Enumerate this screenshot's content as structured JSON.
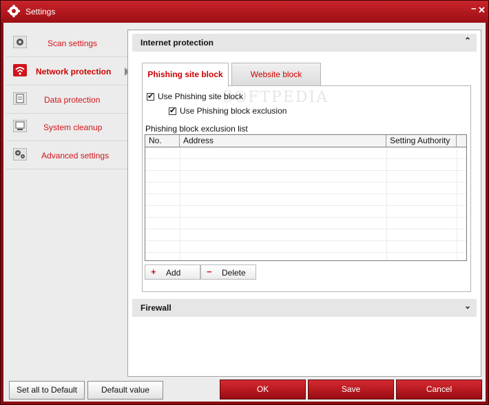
{
  "window": {
    "title": "Settings",
    "minimize": "−",
    "close": "✕"
  },
  "sidebar": {
    "items": [
      {
        "label": "Scan settings",
        "icon": "gear-icon"
      },
      {
        "label": "Network protection",
        "icon": "wifi-icon",
        "active": true
      },
      {
        "label": "Data protection",
        "icon": "document-icon"
      },
      {
        "label": "System cleanup",
        "icon": "monitor-icon"
      },
      {
        "label": "Advanced settings",
        "icon": "gears-icon"
      }
    ]
  },
  "sections": {
    "internet": {
      "title": "Internet protection",
      "chevron": "⌃"
    },
    "firewall": {
      "title": "Firewall",
      "chevron": "⌄"
    }
  },
  "tabs": [
    {
      "label": "Phishing site block",
      "active": true
    },
    {
      "label": "Website block",
      "active": false
    }
  ],
  "phishing": {
    "use_block": {
      "label": "Use Phishing site block",
      "checked": true
    },
    "use_exclusion": {
      "label": "Use Phishing block exclusion",
      "checked": true
    },
    "list_caption": "Phishing block exclusion list",
    "columns": [
      "No.",
      "Address",
      "Setting Authority"
    ],
    "rows": [],
    "add_label": "Add",
    "add_symbol": "+",
    "delete_label": "Delete",
    "delete_symbol": "−"
  },
  "footer": {
    "set_all_default": "Set all to Default",
    "default_value": "Default value",
    "ok": "OK",
    "save": "Save",
    "cancel": "Cancel"
  },
  "colors": {
    "accent": "#cc0000",
    "titlebar": "#b3181e"
  }
}
